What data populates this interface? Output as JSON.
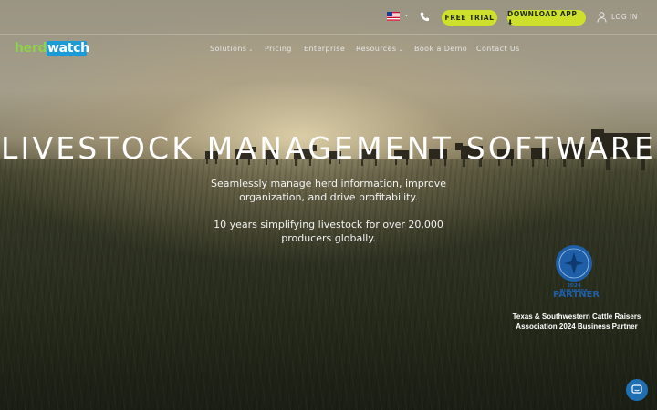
{
  "topbar": {
    "flag_icon": "us-flag-icon",
    "flag_caret": "⌄",
    "phone_icon": "phone-icon",
    "free_trial_label": "FREE TRIAL",
    "download_label": "DOWNLOAD APP ⬇",
    "user_icon": "user-icon",
    "login_label": "LOG IN"
  },
  "logo": {
    "part1": "herd",
    "part2": "watch",
    "color_herd": "#8ed14a",
    "color_watch": "#ffffff",
    "color_box": "#1a9ad6"
  },
  "nav": {
    "items": [
      {
        "label": "Solutions",
        "caret": "⌄"
      },
      {
        "label": "Pricing"
      },
      {
        "label": "Enterprise"
      },
      {
        "label": "Resources",
        "caret": "⌄"
      },
      {
        "label": "Book a Demo"
      },
      {
        "label": "Contact Us"
      }
    ]
  },
  "hero": {
    "headline": "LIVESTOCK MANAGEMENT SOFTWARE",
    "sub1": "Seamlessly manage herd information, improve organization, and drive profitability.",
    "sub2": "10 years simplifying livestock for over 20,000 producers globally."
  },
  "badge": {
    "year_text": "2024 BUSINESS",
    "partner_text": "PARTNER",
    "caption": "Texas & Southwestern Cattle Raisers Association 2024 Business Partner",
    "color": "#1f5fa8"
  },
  "chat": {
    "icon": "chat-icon"
  },
  "colors": {
    "accent": "#cfe02c"
  }
}
